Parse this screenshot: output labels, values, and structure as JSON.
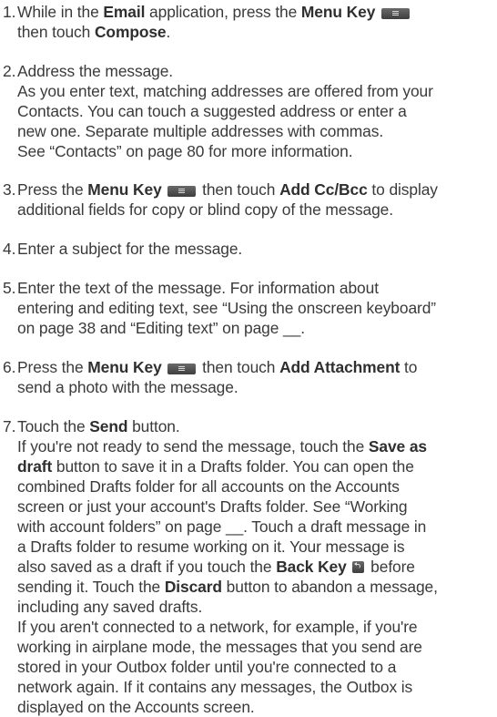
{
  "steps": [
    {
      "num": "1.",
      "t1": "While in the ",
      "b1": "Email",
      "t2": " application, press the ",
      "b2": "Menu Key",
      "t3": "then touch ",
      "b3": "Compose",
      "t4": "."
    },
    {
      "num": "2.",
      "intro": "Address the message.",
      "l1": "As you enter text, matching addresses are offered from your",
      "l2": "Contacts. You can touch a suggested address or enter a",
      "l3": "new one. Separate multiple addresses with commas.",
      "l4": "See “Contacts” on page 80 for more information."
    },
    {
      "num": "3.",
      "t1": "Press the ",
      "b1": "Menu Key",
      "t2": " then touch ",
      "b2": "Add Cc/Bcc",
      "t3": " to display",
      "l2": "additional fields for copy or blind copy of the message."
    },
    {
      "num": "4.",
      "text": "Enter a subject for the message."
    },
    {
      "num": "5.",
      "l1": "Enter the text of the message. For information about",
      "l2": "entering and editing text, see “Using the onscreen keyboard”",
      "l3": "on page 38 and “Editing text” on page __."
    },
    {
      "num": "6.",
      "t1": "Press the ",
      "b1": "Menu Key",
      "t2": " then touch ",
      "b2": "Add Attachment",
      "t3": " to",
      "l2": "send a photo with the message."
    },
    {
      "num": "7.",
      "t1": "Touch the ",
      "b1": "Send",
      "t2": " button.",
      "p2a": "If you're not ready to send the message, touch the ",
      "p2b": "Save as",
      "p2c": "draft",
      "p2d": " button to save it in a Drafts folder. You can open the",
      "p2e": "combined Drafts folder for all accounts on the Accounts",
      "p2f": "screen or just your account's Drafts folder. See “Working",
      "p2g": "with account folders” on page __. Touch a draft message in",
      "p2h": "a Drafts folder to resume working on it. Your message is",
      "p2i": "also saved as a draft if you touch the ",
      "p2j": "Back Key",
      "p2k": " before",
      "p2l": "sending it. Touch the ",
      "p2m": "Discard",
      "p2n": " button to abandon a message,",
      "p2o": "including any saved drafts.",
      "p3a": "If you aren't connected to a network, for example, if you're",
      "p3b": "working in airplane mode, the messages that you send are",
      "p3c": "stored in your Outbox folder until you're connected to a",
      "p3d": "network again. If it contains any messages, the Outbox is",
      "p3e": "displayed on the Accounts screen."
    }
  ],
  "icons": {
    "menu_key": "menu-key-icon",
    "back_key": "back-key-icon"
  }
}
